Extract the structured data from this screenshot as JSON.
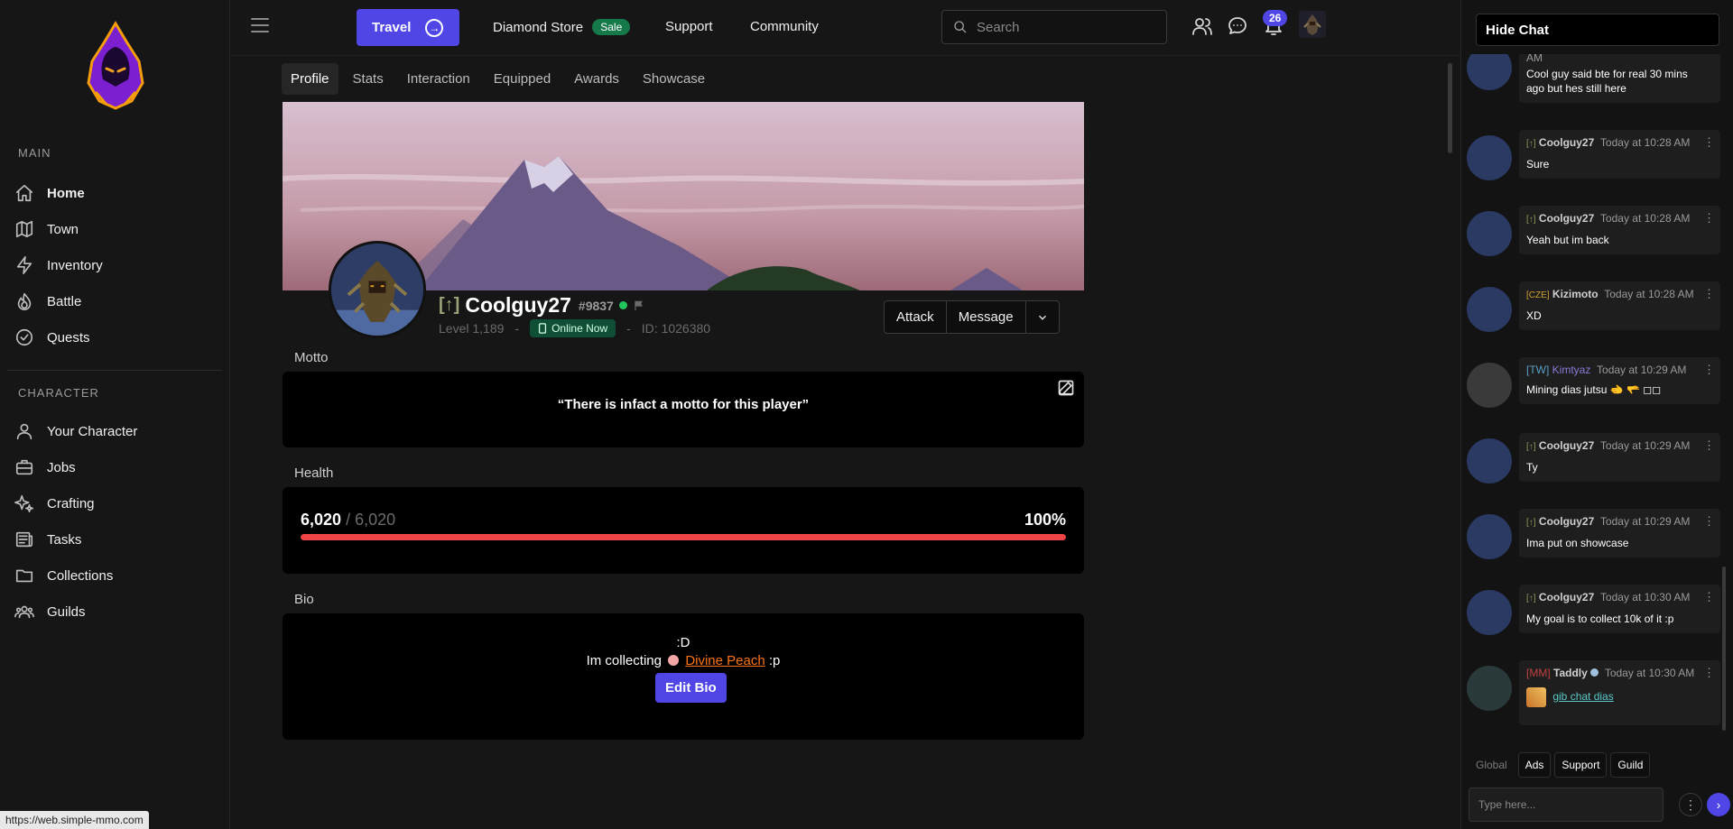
{
  "app": {
    "status_url": "https://web.simple-mmo.com"
  },
  "sidebar": {
    "main_label": "MAIN",
    "main_items": [
      {
        "label": "Home",
        "icon": "home-icon"
      },
      {
        "label": "Town",
        "icon": "map-icon"
      },
      {
        "label": "Inventory",
        "icon": "bolt-icon"
      },
      {
        "label": "Battle",
        "icon": "fire-icon"
      },
      {
        "label": "Quests",
        "icon": "check-circle-icon"
      }
    ],
    "character_label": "CHARACTER",
    "character_items": [
      {
        "label": "Your Character",
        "icon": "user-icon"
      },
      {
        "label": "Jobs",
        "icon": "briefcase-icon"
      },
      {
        "label": "Crafting",
        "icon": "sparkles-icon"
      },
      {
        "label": "Tasks",
        "icon": "newspaper-icon"
      },
      {
        "label": "Collections",
        "icon": "folder-icon"
      },
      {
        "label": "Guilds",
        "icon": "users-icon"
      }
    ]
  },
  "topbar": {
    "travel_label": "Travel",
    "diamond_store": "Diamond Store",
    "sale_badge": "Sale",
    "support": "Support",
    "community": "Community",
    "search_placeholder": "Search",
    "notification_count": "26"
  },
  "profile": {
    "tabs": [
      "Profile",
      "Stats",
      "Interaction",
      "Equipped",
      "Awards",
      "Showcase"
    ],
    "active_tab": "Profile",
    "guild_tag": "[↑]",
    "name": "Coolguy27",
    "user_tag": "#9837",
    "level": "Level 1,189",
    "online_status": "Online Now",
    "player_id": "ID: 1026380",
    "sep": "-",
    "actions": {
      "attack": "Attack",
      "message": "Message"
    },
    "motto_label": "Motto",
    "motto": "“There is infact a motto for this player”",
    "health_label": "Health",
    "health_current": "6,020",
    "health_max": "/ 6,020",
    "health_percent_text": "100%",
    "health_fraction": 1.0,
    "bio_label": "Bio",
    "bio_line1": ":D",
    "bio_line2_prefix": "Im collecting",
    "bio_item": "Divine Peach",
    "bio_line2_suffix": ":p",
    "edit_bio": "Edit Bio"
  },
  "chat": {
    "hide_label": "Hide Chat",
    "messages": [
      {
        "tag": "",
        "user": "",
        "time": "AM",
        "text": "Cool guy said bte for real 30 mins ago but hes still here"
      },
      {
        "tag": "[↑]",
        "user": "Coolguy27",
        "time": "Today at 10:28 AM",
        "text": "Sure"
      },
      {
        "tag": "[↑]",
        "user": "Coolguy27",
        "time": "Today at 10:28 AM",
        "text": "Yeah but im back"
      },
      {
        "tag": "[CZE]",
        "user": "Kizimoto",
        "time": "Today at 10:28 AM",
        "text": "XD"
      },
      {
        "tag": "[TW]",
        "user": "Kimtyaz",
        "time": "Today at 10:29 AM",
        "text": "Mining dias jutsu 🫲 🫳 ◻◻"
      },
      {
        "tag": "[↑]",
        "user": "Coolguy27",
        "time": "Today at 10:29 AM",
        "text": "Ty"
      },
      {
        "tag": "[↑]",
        "user": "Coolguy27",
        "time": "Today at 10:29 AM",
        "text": "Ima put on showcase"
      },
      {
        "tag": "[↑]",
        "user": "Coolguy27",
        "time": "Today at 10:30 AM",
        "text": "My goal is to collect 10k of it :p"
      },
      {
        "tag": "[MM]",
        "user": "Taddly",
        "time": "Today at 10:30 AM",
        "text": "gib chat dias"
      }
    ],
    "tabs": [
      "Global",
      "Ads",
      "Support",
      "Guild"
    ],
    "input_placeholder": "Type here..."
  }
}
